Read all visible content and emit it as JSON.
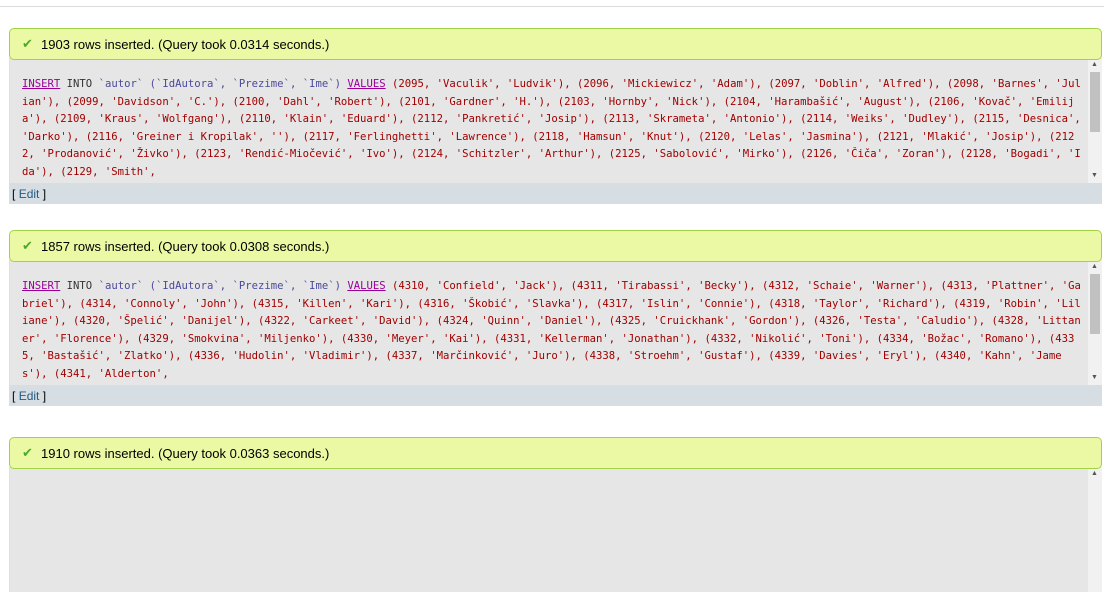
{
  "results": [
    {
      "message": "1903 rows inserted. (Query took 0.0314 seconds.)",
      "sql_prefix": {
        "insert": "INSERT",
        "into": "INTO",
        "table": "`autor`",
        "columns": "(`IdAutora`, `Prezime`, `Ime`)",
        "values": "VALUES"
      },
      "sql_body": "(2095, 'Vaculik', 'Ludvik'), (2096, 'Mickiewicz', 'Adam'), (2097, 'Doblin', 'Alfred'), (2098, 'Barnes', 'Julian'), (2099, 'Davidson', 'C.'), (2100, 'Dahl', 'Robert'), (2101, 'Gardner', 'H.'), (2103, 'Hornby', 'Nick'), (2104, 'Harambašić', 'August'), (2106, 'Kovač', 'Emilija'), (2109, 'Kraus', 'Wolfgang'), (2110, 'Klain', 'Eduard'), (2112, 'Pankretić', 'Josip'), (2113, 'Skrameta', 'Antonio'), (2114, 'Weiks', 'Dudley'), (2115, 'Desnica', 'Darko'), (2116, 'Greiner i Kropilak', ''), (2117, 'Ferlinghetti', 'Lawrence'), (2118, 'Hamsun', 'Knut'), (2120, 'Lelas', 'Jasmina'), (2121, 'Mlakić', 'Josip'), (2122, 'Prodanović', 'Živko'), (2123, 'Rendić-Miočević', 'Ivo'), (2124, 'Schitzler', 'Arthur'), (2125, 'Sabolović', 'Mirko'), (2126, 'Čiča', 'Zoran'), (2128, 'Bogadi', 'Ida'), (2129, 'Smith',",
      "edit_label": "Edit"
    },
    {
      "message": "1857 rows inserted. (Query took 0.0308 seconds.)",
      "sql_prefix": {
        "insert": "INSERT",
        "into": "INTO",
        "table": "`autor`",
        "columns": "(`IdAutora`, `Prezime`, `Ime`)",
        "values": "VALUES"
      },
      "sql_body": "(4310, 'Confield', 'Jack'), (4311, 'Tirabassi', 'Becky'), (4312, 'Schaie', 'Warner'), (4313, 'Plattner', 'Gabriel'), (4314, 'Connoly', 'John'), (4315, 'Killen', 'Kari'), (4316, 'Škobić', 'Slavka'), (4317, 'Islin', 'Connie'), (4318, 'Taylor', 'Richard'), (4319, 'Robin', 'Liliane'), (4320, 'Špelić', 'Danijel'), (4322, 'Carkeet', 'David'), (4324, 'Quinn', 'Daniel'), (4325, 'Cruickhank', 'Gordon'), (4326, 'Testa', 'Caludio'), (4328, 'Littaner', 'Florence'), (4329, 'Smokvina', 'Miljenko'), (4330, 'Meyer', 'Kai'), (4331, 'Kellerman', 'Jonathan'), (4332, 'Nikolić', 'Toni'), (4334, 'Božac', 'Romano'), (4335, 'Bastašić', 'Zlatko'), (4336, 'Hudolin', 'Vladimir'), (4337, 'Marčinković', 'Juro'), (4338, 'Stroehm', 'Gustaf'), (4339, 'Davies', 'Eryl'), (4340, 'Kahn', 'James'), (4341, 'Alderton',",
      "edit_label": "Edit"
    },
    {
      "message": "1910 rows inserted. (Query took 0.0363 seconds.)"
    }
  ],
  "icons": {
    "success": "checkmark-icon",
    "scroll_up": "arrow-up-icon",
    "scroll_down": "arrow-down-icon"
  },
  "colors": {
    "success_bg": "#ebf8a4",
    "success_border": "#a2d246",
    "sql_bg": "#e6e6e6",
    "keyword": "#990099",
    "string": "#a00000",
    "link": "#235a81"
  }
}
